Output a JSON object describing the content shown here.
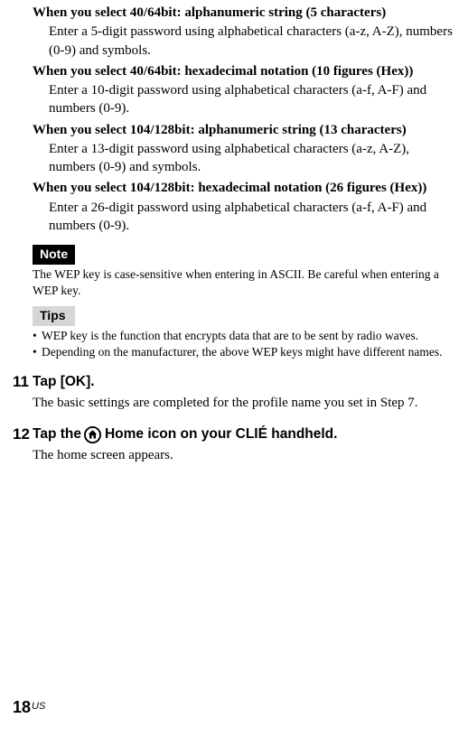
{
  "wep": [
    {
      "title": "When you select 40/64bit: alphanumeric string (5 characters)",
      "desc": "Enter a 5-digit password using alphabetical characters (a-z, A-Z), numbers (0-9) and symbols."
    },
    {
      "title": "When you select 40/64bit: hexadecimal notation (10 figures (Hex))",
      "desc": "Enter a 10-digit password using alphabetical characters (a-f, A-F) and numbers (0-9)."
    },
    {
      "title": "When you select 104/128bit: alphanumeric string (13 characters)",
      "desc": "Enter a 13-digit password using alphabetical characters (a-z, A-Z), numbers (0-9) and symbols."
    },
    {
      "title": "When you select 104/128bit: hexadecimal notation (26 figures (Hex))",
      "desc": "Enter a 26-digit password using alphabetical characters (a-f, A-F) and numbers (0-9)."
    }
  ],
  "note": {
    "label": "Note",
    "text": "The WEP key is case-sensitive when entering in ASCII. Be careful when entering a WEP key."
  },
  "tips": {
    "label": "Tips",
    "items": [
      "WEP key is the function that encrypts data that are to be sent by radio waves.",
      "Depending on the manufacturer, the above WEP keys might have different names."
    ]
  },
  "steps": {
    "s11": {
      "num": "11",
      "title": "Tap [OK].",
      "desc": "The basic settings are completed for the profile name you set in Step 7."
    },
    "s12": {
      "num": "12",
      "title_a": "Tap the ",
      "title_b": " Home icon on your CLIÉ handheld.",
      "desc": "The home screen appears."
    }
  },
  "page": {
    "num": "18",
    "suffix": "US"
  }
}
